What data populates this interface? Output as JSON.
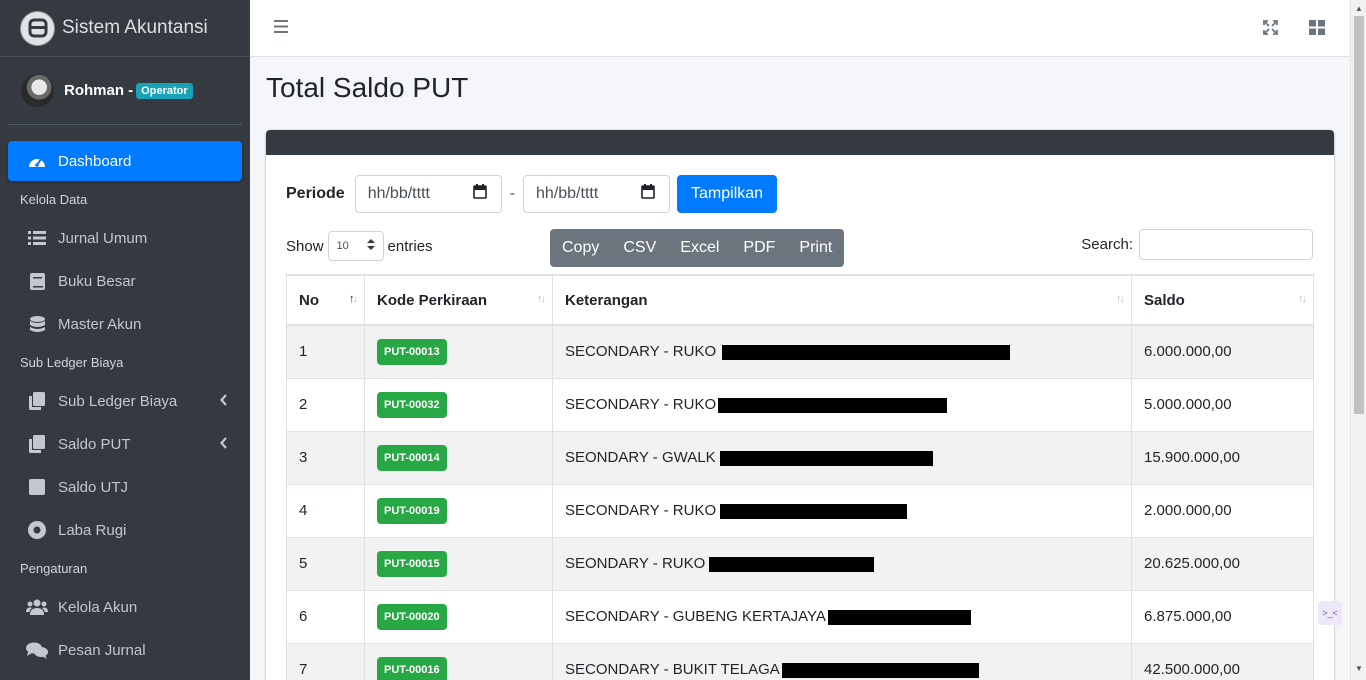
{
  "app": {
    "brand": "Sistem Akuntansi"
  },
  "user": {
    "name": "Rohman -",
    "role": "Operator"
  },
  "sidebar": {
    "active": {
      "label": "Dashboard",
      "icon": "tachometer-icon"
    },
    "sections": [
      {
        "header": "Kelola Data",
        "items": [
          {
            "label": "Jurnal Umum",
            "icon": "list-icon"
          },
          {
            "label": "Buku Besar",
            "icon": "book-icon"
          },
          {
            "label": "Master Akun",
            "icon": "database-icon"
          }
        ]
      },
      {
        "header": "Sub Ledger Biaya",
        "items": [
          {
            "label": "Sub Ledger Biaya",
            "icon": "copy-icon"
          },
          {
            "label": "Saldo PUT",
            "icon": "copy-icon"
          },
          {
            "label": "Saldo UTJ",
            "icon": "square-icon"
          },
          {
            "label": "Laba Rugi",
            "icon": "circle-dot-icon"
          }
        ]
      },
      {
        "header": "Pengaturan",
        "items": [
          {
            "label": "Kelola Akun",
            "icon": "users-icon"
          },
          {
            "label": "Pesan Jurnal",
            "icon": "comments-icon"
          }
        ]
      }
    ]
  },
  "page": {
    "title": "Total Saldo PUT"
  },
  "filter": {
    "label": "Periode",
    "date_from_placeholder": "hh/bb/tttt",
    "separator": "-",
    "date_to_placeholder": "hh/bb/tttt",
    "submit": "Tampilkan"
  },
  "table_controls": {
    "show": "Show",
    "length": "10",
    "entries": "entries",
    "buttons": [
      "Copy",
      "CSV",
      "Excel",
      "PDF",
      "Print"
    ],
    "search_label": "Search:"
  },
  "table": {
    "columns": [
      "No",
      "Kode Perkiraan",
      "Keterangan",
      "Saldo"
    ],
    "rows": [
      {
        "no": "1",
        "kode": "PUT-00013",
        "keterangan": "SECONDARY - RUKO",
        "saldo": "6.000.000,00"
      },
      {
        "no": "2",
        "kode": "PUT-00032",
        "keterangan": "SECONDARY - RUKO",
        "saldo": "5.000.000,00"
      },
      {
        "no": "3",
        "kode": "PUT-00014",
        "keterangan": "SEONDARY - GWALK",
        "saldo": "15.900.000,00"
      },
      {
        "no": "4",
        "kode": "PUT-00019",
        "keterangan": "SECONDARY - RUKO",
        "saldo": "2.000.000,00"
      },
      {
        "no": "5",
        "kode": "PUT-00015",
        "keterangan": "SEONDARY - RUKO",
        "saldo": "20.625.000,00"
      },
      {
        "no": "6",
        "kode": "PUT-00020",
        "keterangan": "SECONDARY - GUBENG KERTAJAYA",
        "saldo": "6.875.000,00"
      },
      {
        "no": "7",
        "kode": "PUT-00016",
        "keterangan": "SECONDARY - BUKIT TELAGA",
        "saldo": "42.500.000,00"
      }
    ]
  },
  "colors": {
    "sidebar": "#343a40",
    "primary": "#007bff",
    "success": "#28a745",
    "info": "#17a2b8",
    "secondary": "#6c757d"
  }
}
